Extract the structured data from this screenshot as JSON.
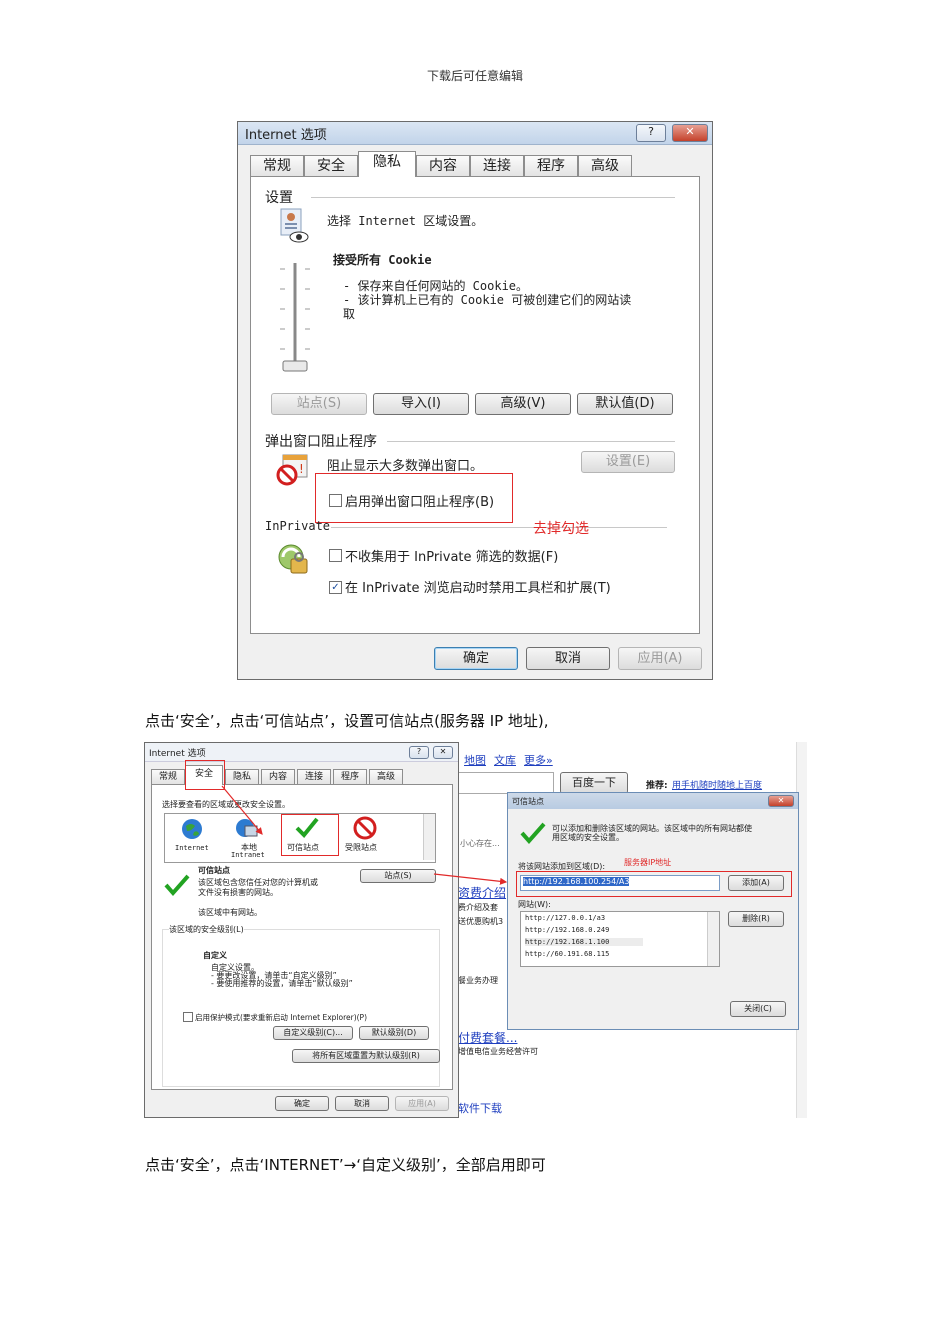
{
  "header": "下载后可任意编辑",
  "dialog1": {
    "title": "Internet 选项",
    "help_btn": "?",
    "close_btn": "✕",
    "tabs": [
      "常规",
      "安全",
      "隐私",
      "内容",
      "连接",
      "程序",
      "高级"
    ],
    "settings_label": "设置",
    "choose_zone": "选择 Internet 区域设置。",
    "cookie_level": "接受所有 Cookie",
    "desc1": "- 保存来自任何网站的 Cookie。",
    "desc2": "- 该计算机上已有的 Cookie 可被创建它们的网站读",
    "desc3": "取",
    "btn_sites": "站点(S)",
    "btn_import": "导入(I)",
    "btn_advanced": "高级(V)",
    "btn_default": "默认值(D)",
    "popup_label": "弹出窗口阻止程序",
    "popup_desc": "阻止显示大多数弹出窗口。",
    "btn_settings": "设置(E)",
    "popup_check": "启用弹出窗口阻止程序(B)",
    "annotation": "去掉勾选",
    "inprivate_label": "InPrivate",
    "inp_check1": "不收集用于 InPrivate 筛选的数据(F)",
    "inp_check2": "在 InPrivate 浏览启动时禁用工具栏和扩展(T)",
    "btn_ok": "确定",
    "btn_cancel": "取消",
    "btn_apply": "应用(A)"
  },
  "para1": "点击‘安全’，点击‘可信站点’，设置可信站点(服务器 IP 地址),",
  "screenshot2": {
    "title": "Internet 选项",
    "tabs": [
      "常规",
      "安全",
      "隐私",
      "内容",
      "连接",
      "程序",
      "高级"
    ],
    "choose_zone": "选择要查看的区域或更改安全设置。",
    "zones": [
      "Internet",
      "本地\nIntranet",
      "可信站点",
      "受限站点"
    ],
    "zone_internet": "Internet",
    "zone_local": "本地",
    "zone_local2": "Intranet",
    "zone_trusted": "可信站点",
    "zone_restricted": "受限站点",
    "trusted_title": "可信站点",
    "trusted_desc1": "该区域包含您信任对您的计算机或",
    "trusted_desc2": "文件没有损害的网站。",
    "btn_sites": "站点(S)",
    "has_sites": "该区域中有网站。",
    "level_label": "该区域的安全级别(L)",
    "custom": "自定义",
    "custom1": "自定义设置。",
    "custom2": "- 要更改设置，请单击“自定义级别”",
    "custom3": "- 要使用推荐的设置，请单击“默认级别”",
    "protect_mode": "启用保护模式(要求重新启动 Internet Explorer)(P)",
    "btn_custom": "自定义级别(C)...",
    "btn_default": "默认级别(D)",
    "btn_reset": "将所有区域重置为默认级别(R)",
    "btn_ok": "确定",
    "btn_cancel": "取消",
    "btn_apply": "应用(A)",
    "bg_map": "地图",
    "bg_wenku": "文库",
    "bg_more": "更多»",
    "bg_baidu": "百度一下",
    "bg_recommend": "推荐:",
    "bg_recommend_link": "用手机随时随地上百度",
    "bg_1": "小心存在...",
    "bg_2": "资费介绍",
    "bg_3": "费介绍及套",
    "bg_4": "送优惠购机3",
    "bg_5": "餐业务办理",
    "bg_6": "付费套餐...",
    "bg_7": "增值电信业务经营许可",
    "bg_8": "软件下载",
    "trusted_dlg": {
      "title": "可信站点",
      "desc1": "可以添加和删除该区域的网站。该区域中的所有网站都使",
      "desc2": "用区域的安全设置。",
      "add_label": "将该网站添加到区域(D):",
      "server_label": "服务器IP地址",
      "input_value": "http://192.168.100.254/A3",
      "btn_add": "添加(A)",
      "sites_label": "网站(W):",
      "sites": [
        "http://127.0.0.1/a3",
        "http://192.168.0.249",
        "http://192.168.1.100",
        "http://60.191.68.115"
      ],
      "btn_remove": "删除(R)",
      "btn_close": "关闭(C)"
    }
  },
  "para2": "点击‘安全’，点击‘INTERNET’→‘自定义级别’，全部启用即可"
}
